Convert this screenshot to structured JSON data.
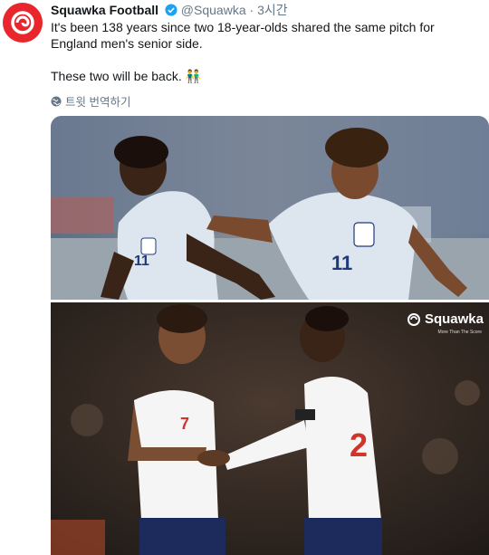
{
  "account": {
    "name": "Squawka Football",
    "handle": "@Squawka",
    "separator": "·",
    "time": "3시간"
  },
  "tweet": {
    "text": "It's been 138 years since two 18-year-olds shared the same pitch for England men's senior side.\n\nThese two will be back. 👬",
    "translate_label": "트윗 번역하기"
  },
  "media": {
    "watermark": "Squawka",
    "watermark_sub": "More Than The Score",
    "shirt_number_top": "11",
    "shirt_number_bottom": "7"
  },
  "colors": {
    "brand": "#e8262c",
    "verified": "#1da1f2",
    "meta_text": "#657786"
  },
  "icons": {
    "avatar": "squawka-logo-icon",
    "verified": "verified-badge-icon",
    "translate": "globe-icon"
  }
}
